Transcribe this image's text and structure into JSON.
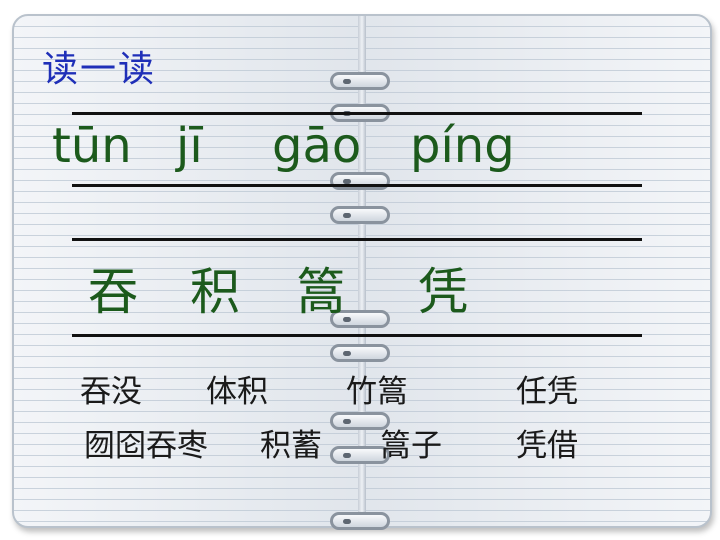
{
  "title": "读一读",
  "pinyin": [
    "tūn",
    "jī",
    "gāo",
    "píng"
  ],
  "characters": [
    "吞",
    "积",
    "篙",
    "凭"
  ],
  "words_row1": [
    "吞没",
    "体积",
    "竹篙",
    "任凭"
  ],
  "words_row2": [
    "囫囵吞枣",
    "积蓄",
    "篙子",
    "凭借"
  ]
}
